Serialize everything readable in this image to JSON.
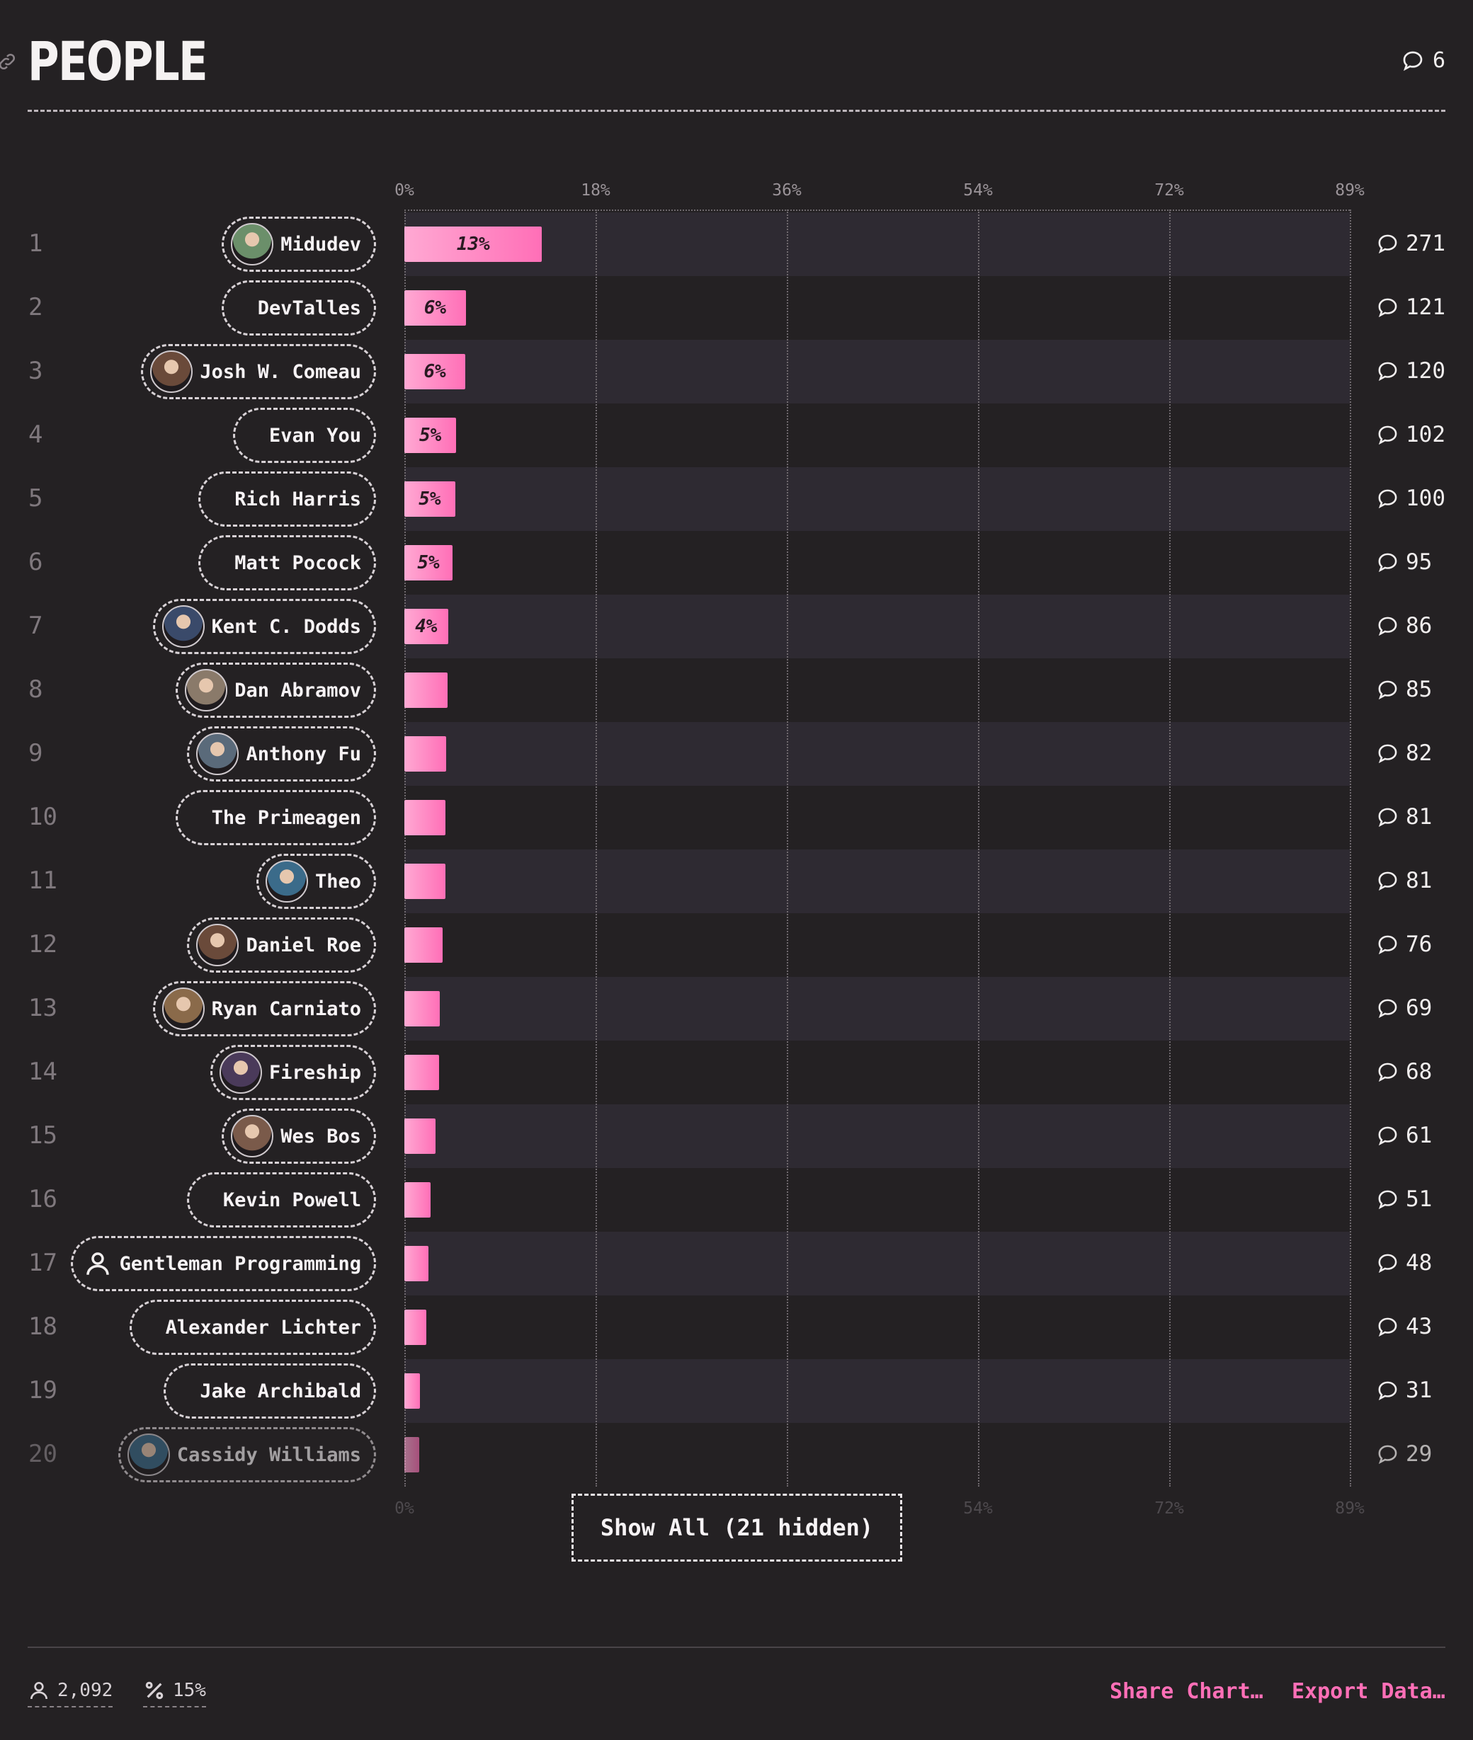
{
  "header": {
    "title": "PEOPLE",
    "comment_count": "6"
  },
  "show_all_label": "Show All (21 hidden)",
  "footer": {
    "respondents": "2,092",
    "percentage": "15%",
    "share_label": "Share Chart…",
    "export_label": "Export Data…"
  },
  "colors": {
    "bar_start": "#ffa9d3",
    "bar_end": "#ff6fb7",
    "background": "#242123",
    "band": "#2e2a32",
    "accent": "#ff6fb7"
  },
  "chart_data": {
    "type": "bar",
    "orientation": "horizontal",
    "xlim": [
      0,
      89
    ],
    "tick_labels": [
      "0%",
      "18%",
      "36%",
      "54%",
      "72%",
      "89%"
    ],
    "grid": true,
    "categories": [
      "Midudev",
      "DevTalles",
      "Josh W. Comeau",
      "Evan You",
      "Rich Harris",
      "Matt Pocock",
      "Kent C. Dodds",
      "Dan Abramov",
      "Anthony Fu",
      "The Primeagen",
      "Theo",
      "Daniel Roe",
      "Ryan Carniato",
      "Fireship",
      "Wes Bos",
      "Kevin Powell",
      "Gentleman Programming",
      "Alexander Lichter",
      "Jake Archibald",
      "Cassidy Williams"
    ],
    "ranks": [
      "1",
      "2",
      "3",
      "4",
      "5",
      "6",
      "7",
      "8",
      "9",
      "10",
      "11",
      "12",
      "13",
      "14",
      "15",
      "16",
      "17",
      "18",
      "19",
      "20"
    ],
    "values": [
      12.96,
      5.78,
      5.74,
      4.88,
      4.78,
      4.54,
      4.11,
      4.06,
      3.92,
      3.87,
      3.87,
      3.63,
      3.3,
      3.25,
      2.92,
      2.44,
      2.29,
      2.06,
      1.48,
      1.39
    ],
    "value_labels": [
      "13%",
      "6%",
      "6%",
      "5%",
      "5%",
      "5%",
      "4%",
      "",
      "",
      "",
      "",
      "",
      "",
      "",
      "",
      "",
      "",
      "",
      "",
      ""
    ],
    "counts": [
      "271",
      "121",
      "120",
      "102",
      "100",
      "95",
      "86",
      "85",
      "82",
      "81",
      "81",
      "76",
      "69",
      "68",
      "61",
      "51",
      "48",
      "43",
      "31",
      "29"
    ],
    "avatar": [
      "photo",
      "none",
      "photo",
      "none",
      "none",
      "none",
      "photo",
      "photo",
      "photo",
      "none",
      "photo",
      "photo",
      "photo",
      "photo",
      "photo",
      "none",
      "user-icon",
      "none",
      "none",
      "photo"
    ]
  }
}
